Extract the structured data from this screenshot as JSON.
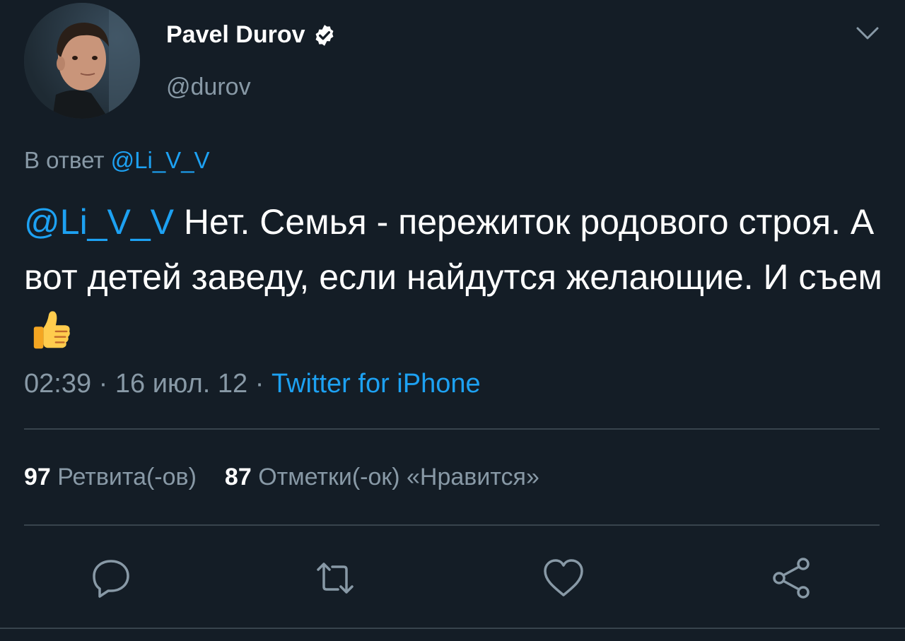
{
  "author": {
    "name": "Pavel Durov",
    "handle": "@durov",
    "avatar_icon": "profile-photo",
    "verified_icon": "verified-badge-icon"
  },
  "reply": {
    "prefix": "В ответ",
    "mention": "@Li_V_V"
  },
  "tweet": {
    "mention": "@Li_V_V",
    "text": " Нет. Семья - пережиток родового строя. А вот детей заведу, если найдутся желающие. И съем",
    "emoji_icon": "thumbs-up-icon"
  },
  "meta": {
    "time": "02:39",
    "separator1": " · ",
    "date": "16 июл. 12",
    "separator2": " · ",
    "source": "Twitter for iPhone"
  },
  "stats": {
    "retweets_count": "97",
    "retweets_label": "Ретвита(-ов)",
    "likes_count": "87",
    "likes_label": "Отметки(-ок) «Нравится»"
  },
  "actions": [
    "reply-icon",
    "retweet-icon",
    "like-icon",
    "share-icon"
  ],
  "colors": {
    "background": "#141d26",
    "accent": "#1da1f2",
    "muted": "#8899a6",
    "divider": "#38444d"
  }
}
